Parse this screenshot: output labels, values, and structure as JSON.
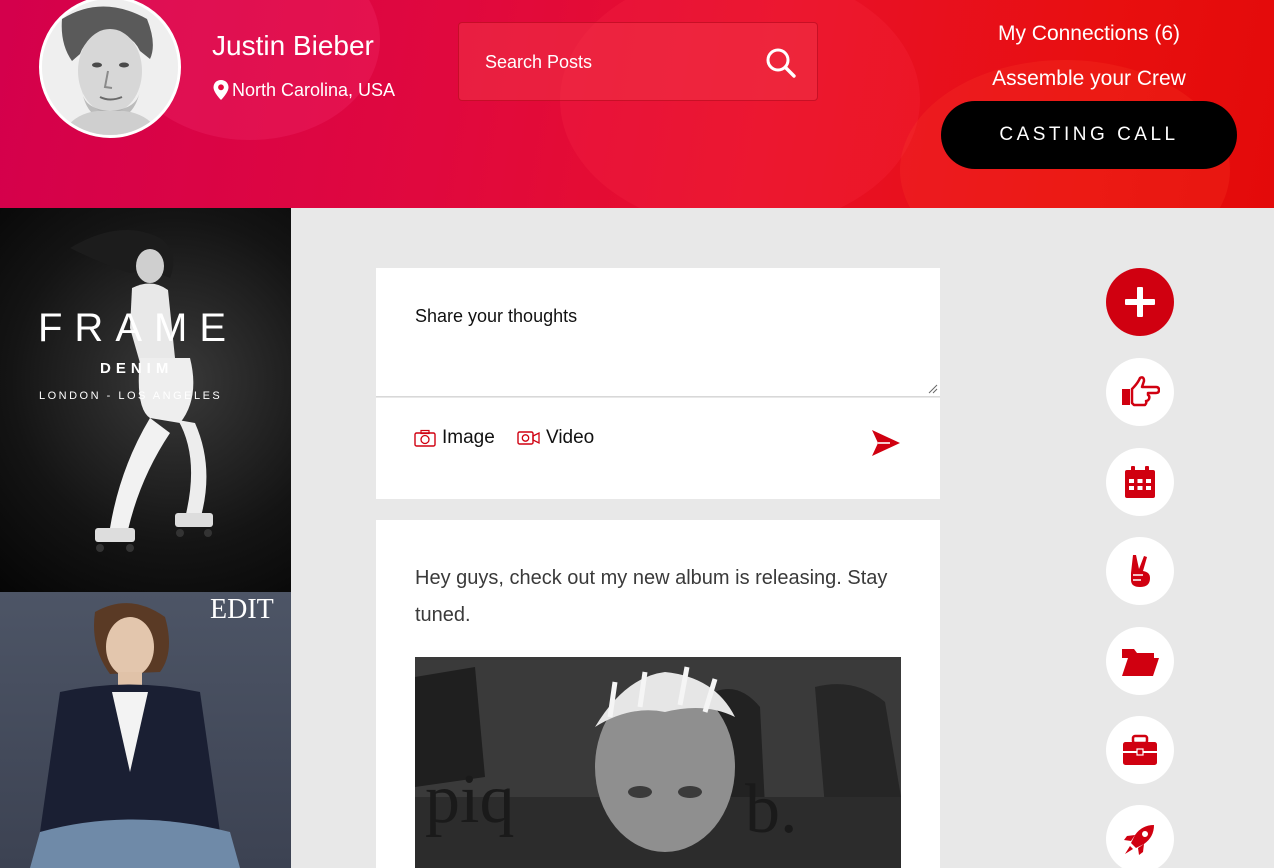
{
  "profile": {
    "name": "Justin Bieber",
    "location": "North Carolina, USA"
  },
  "search": {
    "placeholder": "Search Posts"
  },
  "nav": {
    "connections": "My Connections (6)",
    "crew": "Assemble your Crew",
    "casting_call": "CASTING CALL"
  },
  "ads": {
    "ad1": {
      "brand": "FRAME",
      "sub": "DENIM",
      "cities": "LONDON - LOS ANGELES"
    },
    "ad2": {
      "brand": "EDIT"
    }
  },
  "composer": {
    "placeholder": "Share your thoughts",
    "image_label": "Image",
    "video_label": "Video"
  },
  "post": {
    "text": "Hey guys, check out my new album is releasing. Stay tuned."
  },
  "rail": [
    "plus-icon",
    "pointing-hand-icon",
    "calendar-icon",
    "peace-hand-icon",
    "folder-icon",
    "briefcase-icon",
    "rocket-icon"
  ],
  "colors": {
    "accent": "#d00010",
    "header_start": "#d4004c",
    "header_end": "#e30a0a",
    "button_dark": "#000000",
    "page_bg": "#e8e8e8"
  }
}
